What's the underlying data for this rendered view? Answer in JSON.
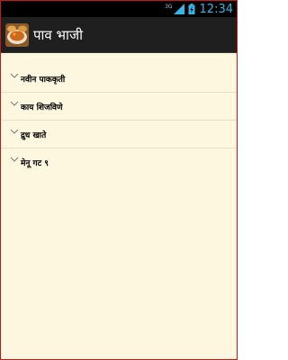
{
  "status_bar": {
    "network_type": "3G",
    "time": "12:34"
  },
  "action_bar": {
    "app_icon": "pav-bhaji-dish-icon",
    "title": "पाव भाजी"
  },
  "menu": {
    "items": [
      {
        "label": "नवीन पाककृती"
      },
      {
        "label": "काय शिजविणे"
      },
      {
        "label": "द्रुध खाते"
      },
      {
        "label": "मेनू गट ९"
      }
    ]
  },
  "colors": {
    "background": "#fdf7df",
    "status_clock": "#33b5e5",
    "action_bar": "#1f1f1f"
  }
}
